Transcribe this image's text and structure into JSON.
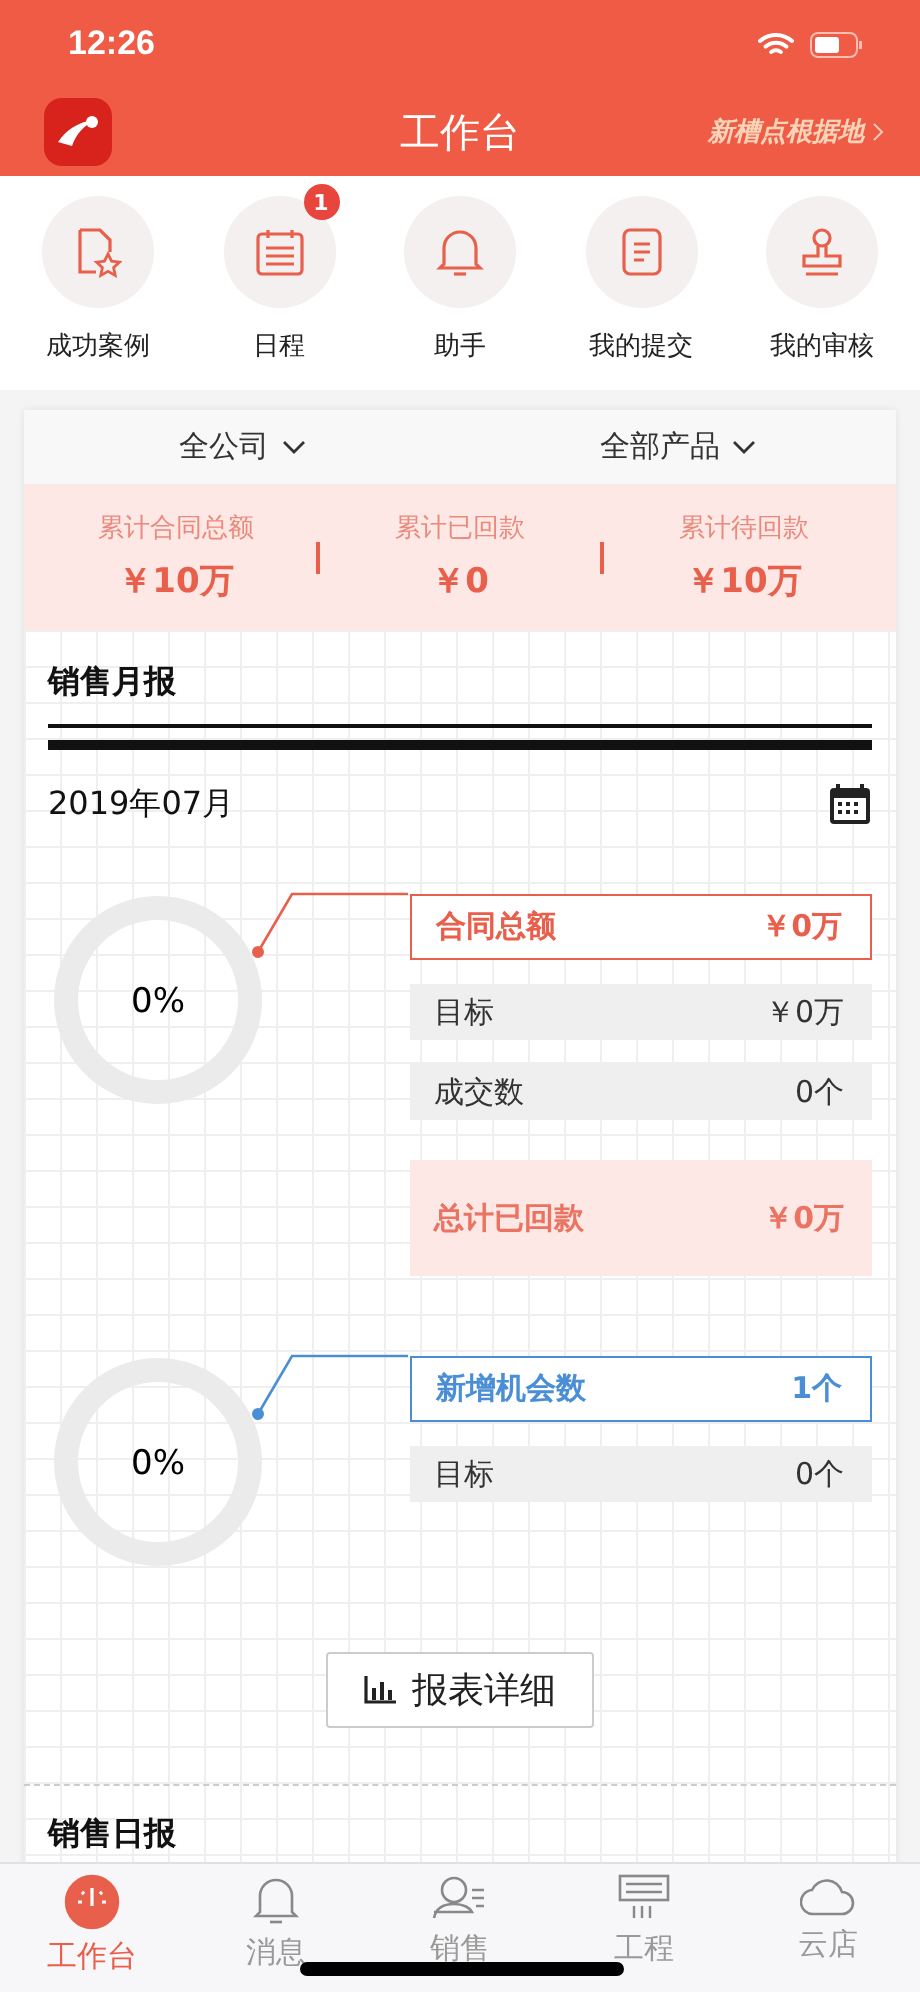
{
  "status_bar": {
    "time": "12:26"
  },
  "header": {
    "title": "工作台",
    "brand": "新槽点根据地"
  },
  "shortcuts": [
    {
      "label": "成功案例"
    },
    {
      "label": "日程",
      "badge": "1"
    },
    {
      "label": "助手"
    },
    {
      "label": "我的提交"
    },
    {
      "label": "我的审核"
    }
  ],
  "filters": [
    {
      "label": "全公司"
    },
    {
      "label": "全部产品"
    }
  ],
  "summary": [
    {
      "label": "累计合同总额",
      "value": "￥10万"
    },
    {
      "label": "累计已回款",
      "value": "￥0"
    },
    {
      "label": "累计待回款",
      "value": "￥10万"
    }
  ],
  "monthly": {
    "title": "销售月报",
    "date": "2019年07月",
    "panels": [
      {
        "percent": "0%",
        "color": "#e8604c",
        "rows": [
          {
            "kind": "head",
            "label": "合同总额",
            "value": "￥0万"
          },
          {
            "kind": "plain",
            "label": "目标",
            "value": "￥0万"
          },
          {
            "kind": "plain",
            "label": "成交数",
            "value": "0个"
          },
          {
            "kind": "total",
            "label": "总计已回款",
            "value": "￥0万"
          }
        ]
      },
      {
        "percent": "0%",
        "color": "#4a8fd6",
        "rows": [
          {
            "kind": "head",
            "label": "新增机会数",
            "value": "1个"
          },
          {
            "kind": "plain",
            "label": "目标",
            "value": "0个"
          }
        ]
      }
    ],
    "button": "报表详细"
  },
  "daily": {
    "title": "销售日报"
  },
  "tabs": [
    {
      "label": "工作台",
      "selected": true
    },
    {
      "label": "消息",
      "selected": false
    },
    {
      "label": "销售",
      "selected": false
    },
    {
      "label": "工程",
      "selected": false
    },
    {
      "label": "云店",
      "selected": false
    }
  ]
}
